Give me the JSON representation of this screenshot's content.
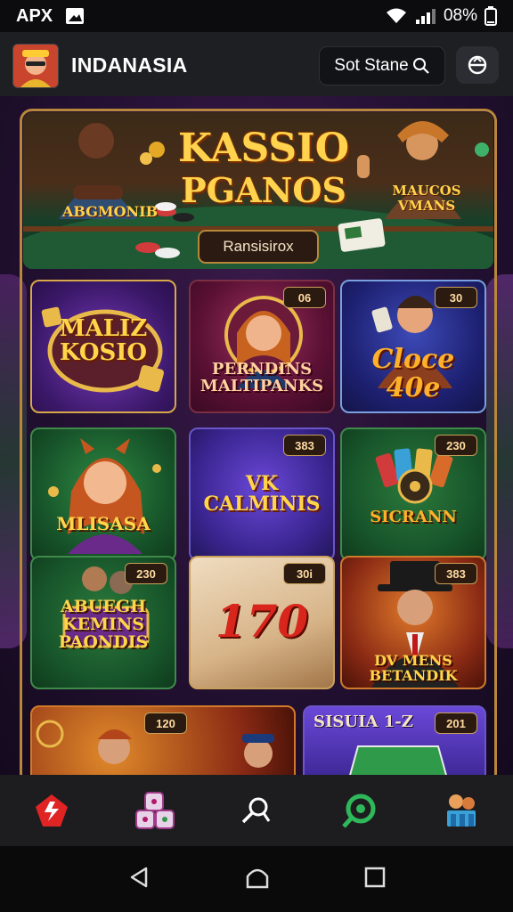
{
  "status_bar": {
    "left_text": "APX",
    "battery": "08%"
  },
  "app": {
    "title": "INDANASIA",
    "search_label": "Sot Stane",
    "accent": "#b8873a"
  },
  "banner": {
    "title_line1": "KASSIO",
    "title_line2": "PGANOS",
    "left_tag": "ABGMONIB",
    "right_tag": "MAUCOS VMANS",
    "button_label": "Ransisirox"
  },
  "tiles": [
    {
      "name": "MALIZ KOSIO",
      "badge": ""
    },
    {
      "name": "PERNDINS MALTIPANKS",
      "badge": "06"
    },
    {
      "name": "Cloce 40e",
      "badge": "30"
    },
    {
      "name": "MLISASA",
      "badge": ""
    },
    {
      "name": "VK CALMINIS",
      "badge": "383"
    },
    {
      "name": "SICRANN",
      "badge": "230"
    },
    {
      "name": "ABUEGH KEMINS PAONDIS",
      "badge": "230"
    },
    {
      "name": "170",
      "badge": "30i"
    },
    {
      "name": "DV MENS BETANDIK",
      "badge": "383"
    },
    {
      "name": "",
      "badge": "120"
    },
    {
      "name": "SISUIA 1-Z",
      "badge": "201"
    }
  ],
  "bottom_nav": [
    "home-icon",
    "dice-icon",
    "search-icon",
    "eye-icon",
    "trophy-icon"
  ],
  "system_nav": [
    "back-icon",
    "home-circle-icon",
    "recents-icon"
  ]
}
